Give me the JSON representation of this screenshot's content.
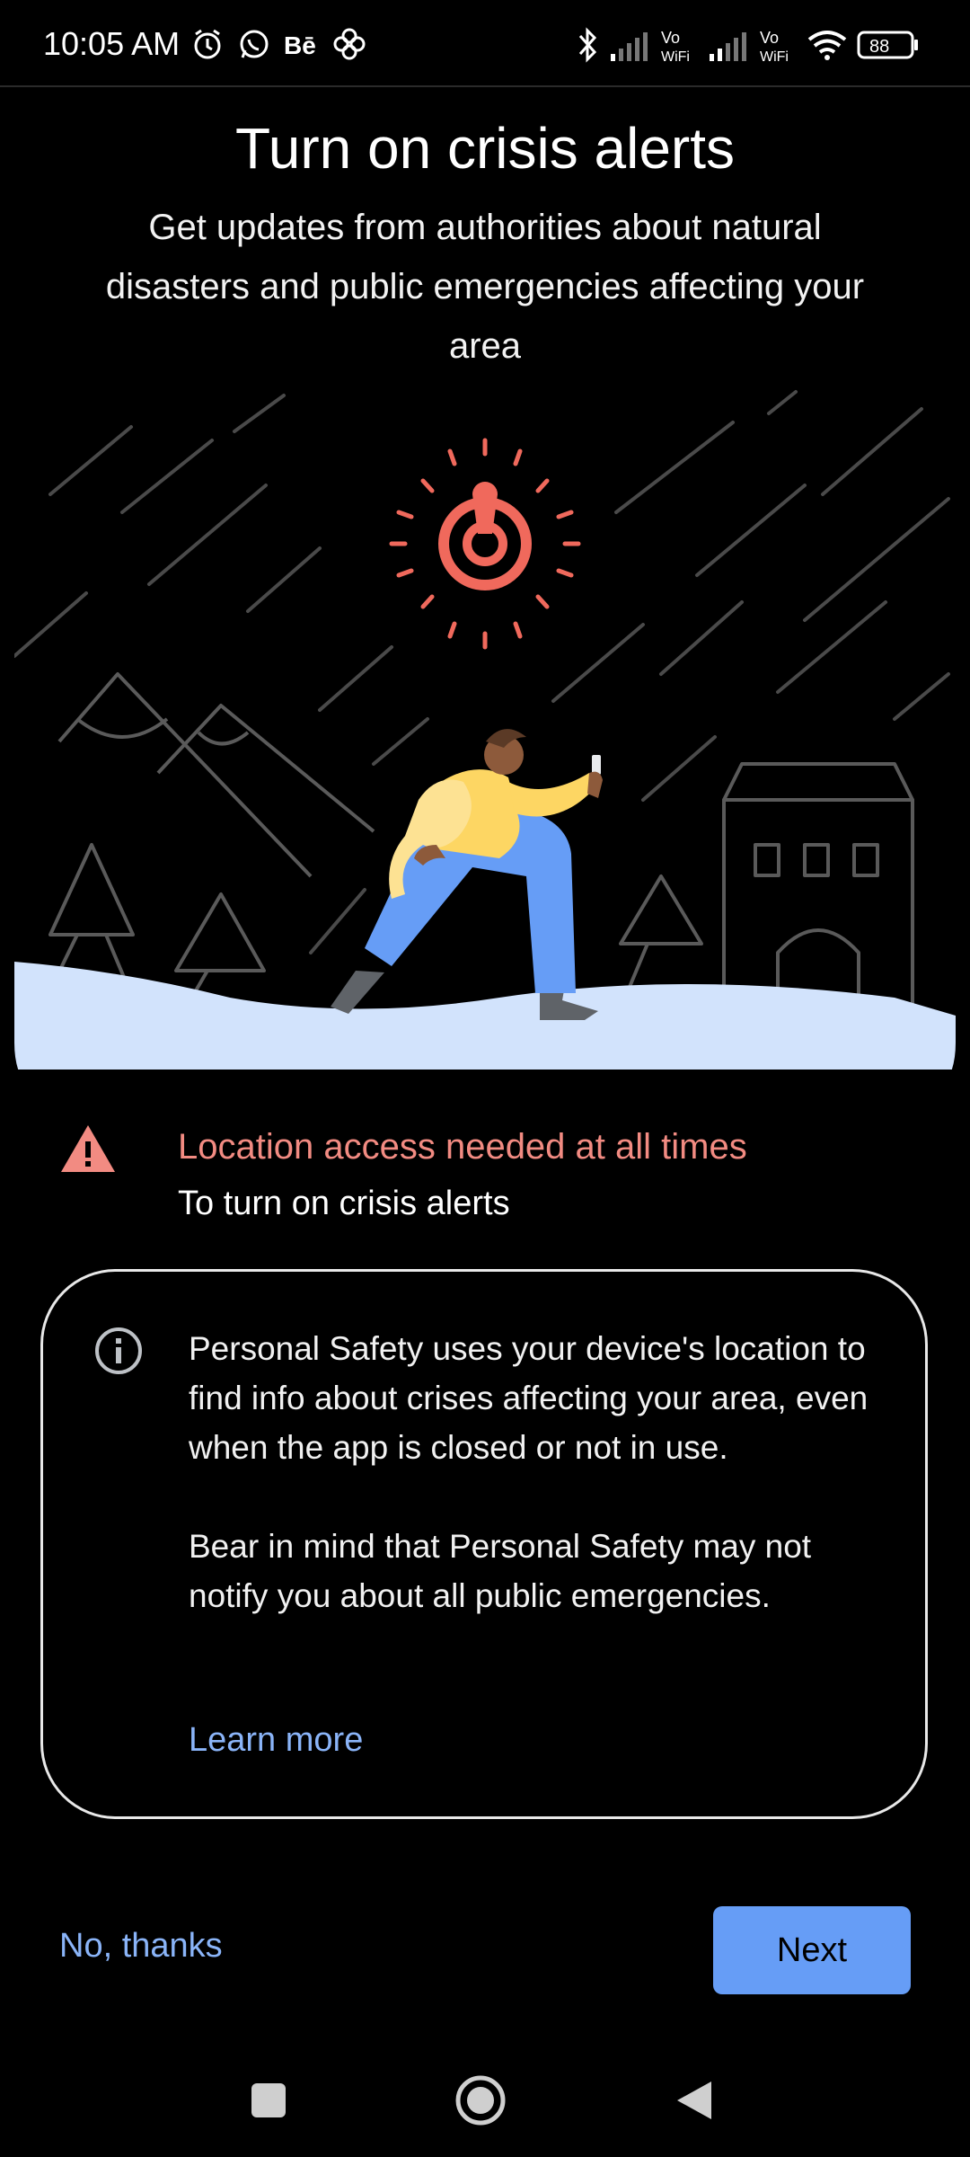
{
  "status_bar": {
    "time": "10:05 AM",
    "battery": "88",
    "icons": [
      "alarm-icon",
      "whatsapp-icon",
      "behance-icon",
      "pinwheel-icon",
      "bluetooth-icon",
      "signal-icon",
      "vowifi-icon",
      "signal-icon",
      "vowifi-icon",
      "wifi-icon",
      "battery-icon"
    ]
  },
  "header": {
    "title": "Turn on crisis alerts",
    "subtitle": "Get updates from authorities about natural disasters and public emergencies affecting your area"
  },
  "warning": {
    "title": "Location access needed at all times",
    "subtitle": "To turn on crisis alerts",
    "color": "#f28b82"
  },
  "info": {
    "paragraph1": "Personal Safety uses your device's location to find info about crises affecting your area, even when the app is closed or not in use.",
    "paragraph2": "Bear in mind that Personal Safety may not notify you about all public emergencies.",
    "link": "Learn more"
  },
  "actions": {
    "secondary": "No, thanks",
    "primary": "Next",
    "accent": "#669df6"
  },
  "nav": {
    "items": [
      "recents-icon",
      "home-icon",
      "back-icon"
    ]
  }
}
